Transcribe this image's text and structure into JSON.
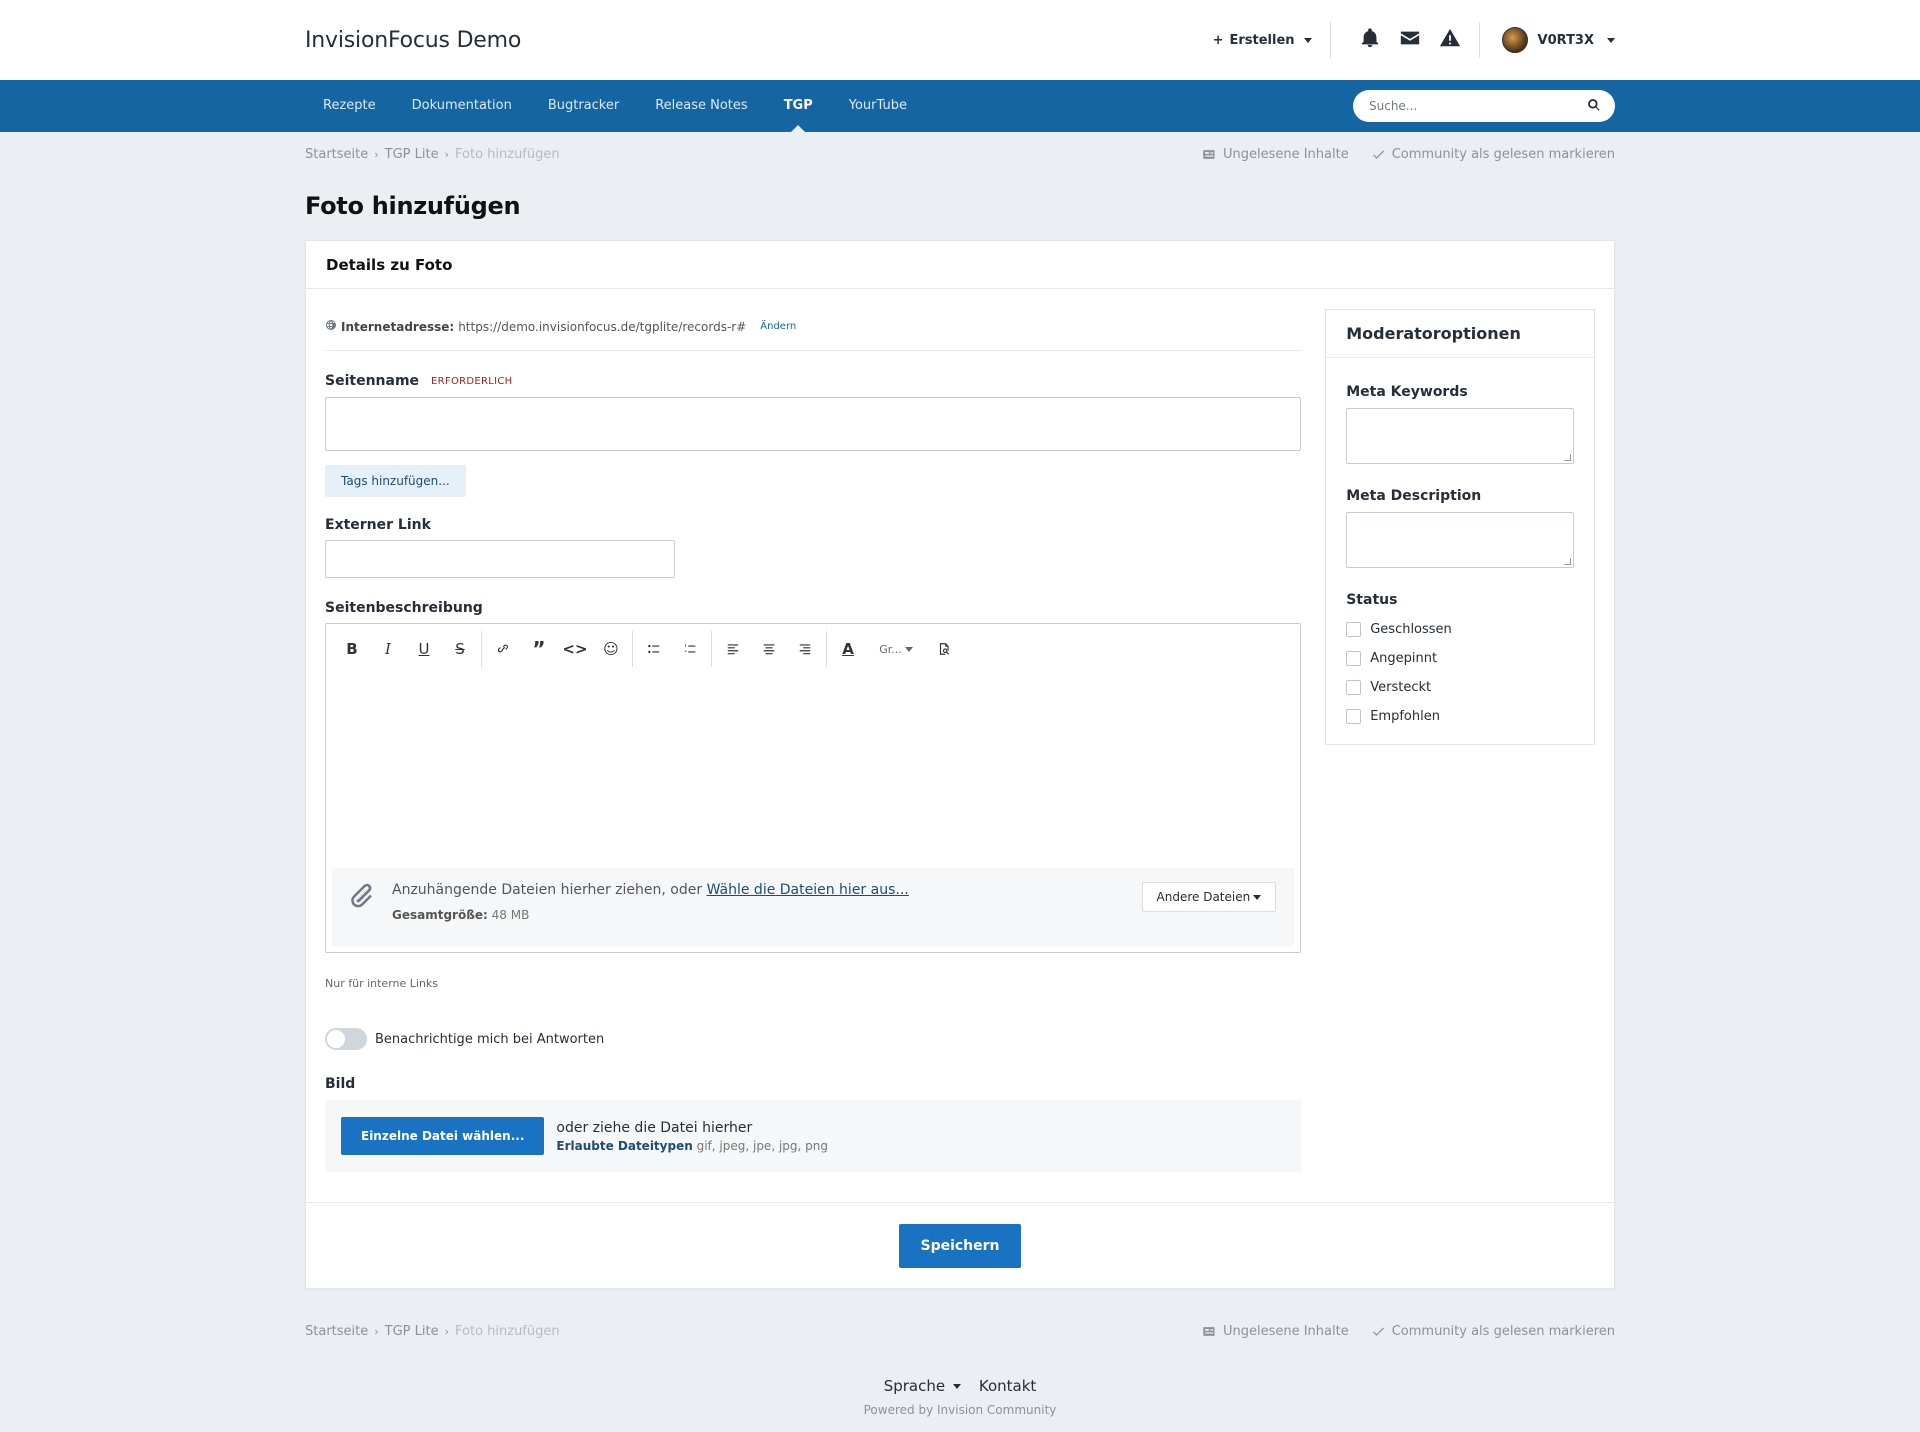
{
  "header": {
    "brand": "InvisionFocus Demo",
    "create_label": "Erstellen",
    "username": "V0RT3X"
  },
  "nav": {
    "items": [
      {
        "label": "Rezepte"
      },
      {
        "label": "Dokumentation"
      },
      {
        "label": "Bugtracker"
      },
      {
        "label": "Release Notes"
      },
      {
        "label": "TGP",
        "active": true
      },
      {
        "label": "YourTube"
      }
    ],
    "search_placeholder": "Suche..."
  },
  "breadcrumb": {
    "items": [
      "Startseite",
      "TGP Lite",
      "Foto hinzufügen"
    ],
    "unread": "Ungelesene Inhalte",
    "mark_read": "Community als gelesen markieren"
  },
  "page": {
    "title": "Foto hinzufügen",
    "box_title": "Details zu Foto"
  },
  "form": {
    "url_label": "Internetadresse:",
    "url_value": "https://demo.invisionfocus.de/tgplite/records-r#",
    "url_change": "Ändern",
    "name_label": "Seitenname",
    "required": "ERFORDERLICH",
    "tags_button": "Tags hinzufügen...",
    "ext_link_label": "Externer Link",
    "desc_label": "Seitenbeschreibung",
    "font_size_label": "Gr...",
    "attach_text": "Anzuhängende Dateien hierher ziehen, oder ",
    "attach_link": "Wähle die Dateien hier aus...",
    "total_size_label": "Gesamtgröße:",
    "total_size_value": "48 MB",
    "other_files": "Andere Dateien",
    "hint": "Nur für interne Links",
    "notify_label": "Benachrichtige mich bei Antworten",
    "image_label": "Bild",
    "upload_button": "Einzelne Datei wählen...",
    "upload_drop": "oder ziehe die Datei hierher",
    "allowed_label": "Erlaubte Dateitypen",
    "allowed_value": "gif, jpeg, jpe, jpg, png",
    "save": "Speichern"
  },
  "moderator": {
    "title": "Moderatoroptionen",
    "keywords_label": "Meta Keywords",
    "description_label": "Meta Description",
    "status_label": "Status",
    "options": [
      "Geschlossen",
      "Angepinnt",
      "Versteckt",
      "Empfohlen"
    ]
  },
  "footer": {
    "language": "Sprache",
    "contact": "Kontakt",
    "powered": "Powered by Invision Community"
  }
}
